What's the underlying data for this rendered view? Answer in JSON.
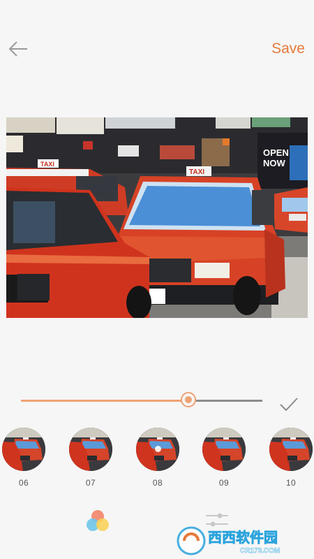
{
  "topbar": {
    "back_icon": "arrow-left-icon",
    "save_label": "Save"
  },
  "photo": {
    "description_icon": "photo-preview",
    "sign_taxi_1": "TAXI",
    "sign_taxi_2": "TAXI",
    "sign_open": "OPEN",
    "sign_now": "NOW"
  },
  "slider": {
    "value": 0.7,
    "icon": "check-icon"
  },
  "filters": {
    "items": [
      {
        "label": "06"
      },
      {
        "label": "07"
      },
      {
        "label": "08",
        "selected": true
      },
      {
        "label": "09"
      },
      {
        "label": "10"
      }
    ]
  },
  "bottombar": {
    "filters_tab_icon": "color-circles-icon",
    "adjust_tab_icon": "sliders-icon"
  },
  "watermark": {
    "brand": "西西软件园",
    "domain": "CR173.COM"
  },
  "colors": {
    "accent": "#e8793a",
    "slider_accent": "#f0a273",
    "background": "#f6f6f6"
  }
}
